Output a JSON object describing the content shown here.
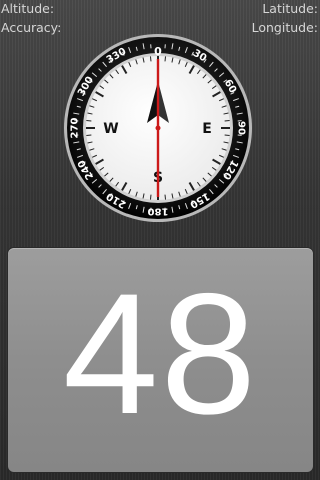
{
  "status": {
    "altitude_label": "Altitude:",
    "latitude_label": "Latitude:",
    "accuracy_label": "Accuracy:",
    "longitude_label": "Longitude:"
  },
  "compass": {
    "cardinals": {
      "north": "0",
      "east": "E",
      "south": "S",
      "west": "W"
    },
    "bezel_labels": [
      "0",
      "30",
      "60",
      "90",
      "120",
      "150",
      "180",
      "210",
      "240",
      "270",
      "300",
      "330"
    ],
    "needle_color": "#cc1a1a"
  },
  "speed": {
    "value": "48"
  }
}
